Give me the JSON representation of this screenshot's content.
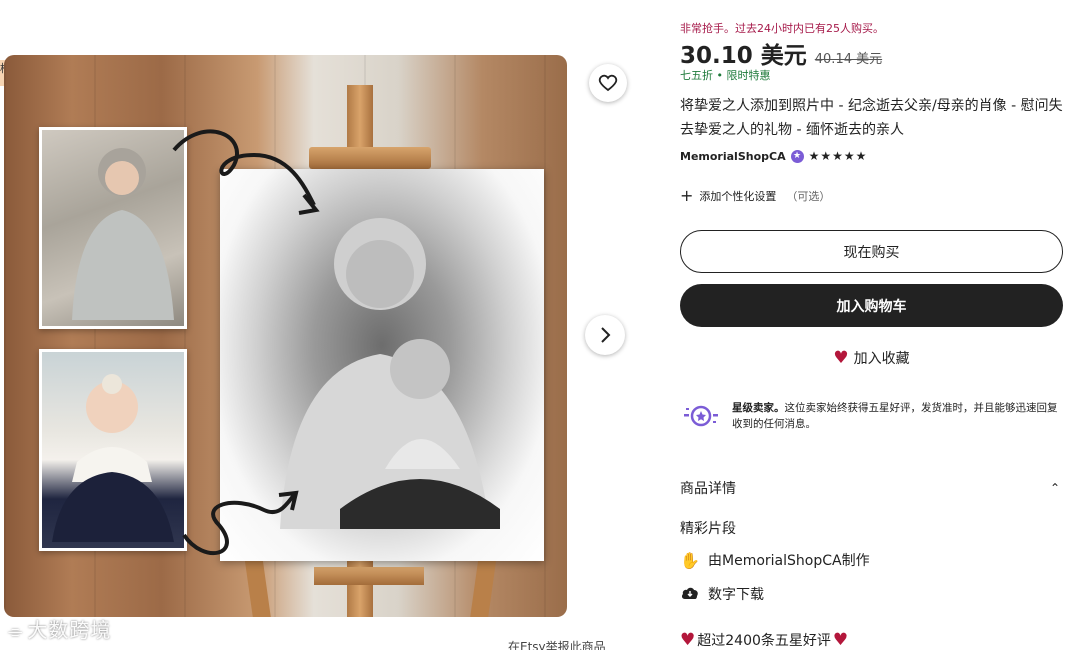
{
  "gallery": {
    "left_tag": "档",
    "favorite_icon": "heart-outline-icon",
    "next_icon": "chevron-right-icon"
  },
  "watermark": {
    "text": "大数跨境"
  },
  "cut_text": "在Etsy举报此商品",
  "product": {
    "urgency": "非常抢手。过去24小时内已有25人购买。",
    "price_now": "30.10 美元",
    "price_old": "40.14 美元",
    "discount": "七五折 • 限时特惠",
    "title": "将挚爱之人添加到照片中 - 纪念逝去父亲/母亲的肖像 - 慰问失去挚爱之人的礼物 - 缅怀逝去的亲人",
    "seller": "MemorialShopCA",
    "stars": "★★★★★",
    "personalize_label": "添加个性化设置",
    "personalize_optional": "（可选）"
  },
  "actions": {
    "buy_now": "现在购买",
    "add_to_cart": "加入购物车",
    "add_to_favorites": "加入收藏"
  },
  "star_seller": {
    "title": "星级卖家。",
    "text": "这位卖家始终获得五星好评，发货准时，并且能够迅速回复收到的任何消息。"
  },
  "details": {
    "heading": "商品详情",
    "highlights_heading": "精彩片段",
    "made_by": "由MemorialShopCA制作",
    "digital": "数字下载",
    "reviews": "超过2400条五星好评"
  },
  "colors": {
    "accent_red": "#b3173b",
    "urgency": "#a61a4a",
    "discount_green": "#1e7a3a",
    "star_seller_purple": "#7b5cd6"
  }
}
